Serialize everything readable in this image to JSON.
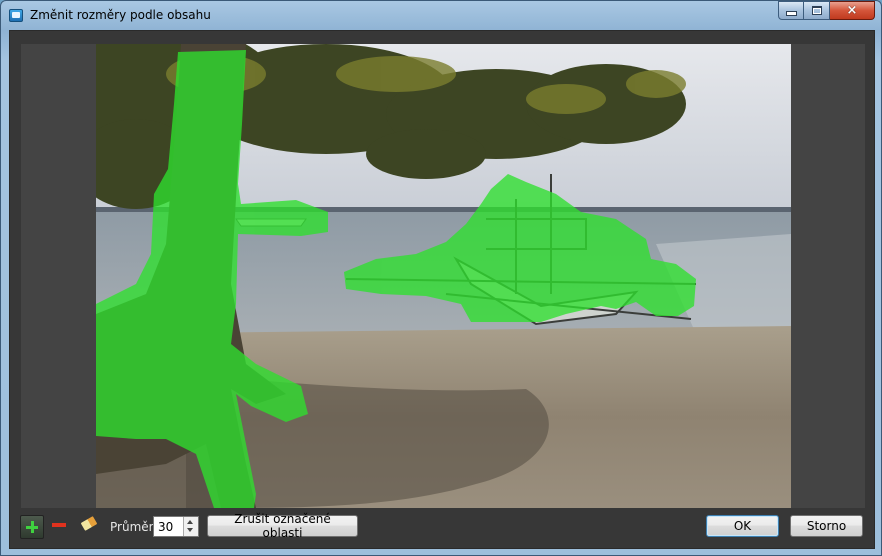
{
  "window": {
    "title": "Změnit rozměry podle obsahu",
    "controls": {
      "minimize": "minimize",
      "maximize": "maximize",
      "close": "×"
    }
  },
  "toolbar": {
    "diameter_label": "Průměr:",
    "diameter_value": "30",
    "clear_label": "Zrušit označené oblasti",
    "ok_label": "OK",
    "cancel_label": "Storno"
  },
  "colors": {
    "mask": "#2ee02e",
    "panel": "#373737",
    "remove": "#e0321e"
  },
  "icons": [
    "add-mask-icon",
    "remove-mask-icon",
    "eraser-icon",
    "app-icon"
  ]
}
